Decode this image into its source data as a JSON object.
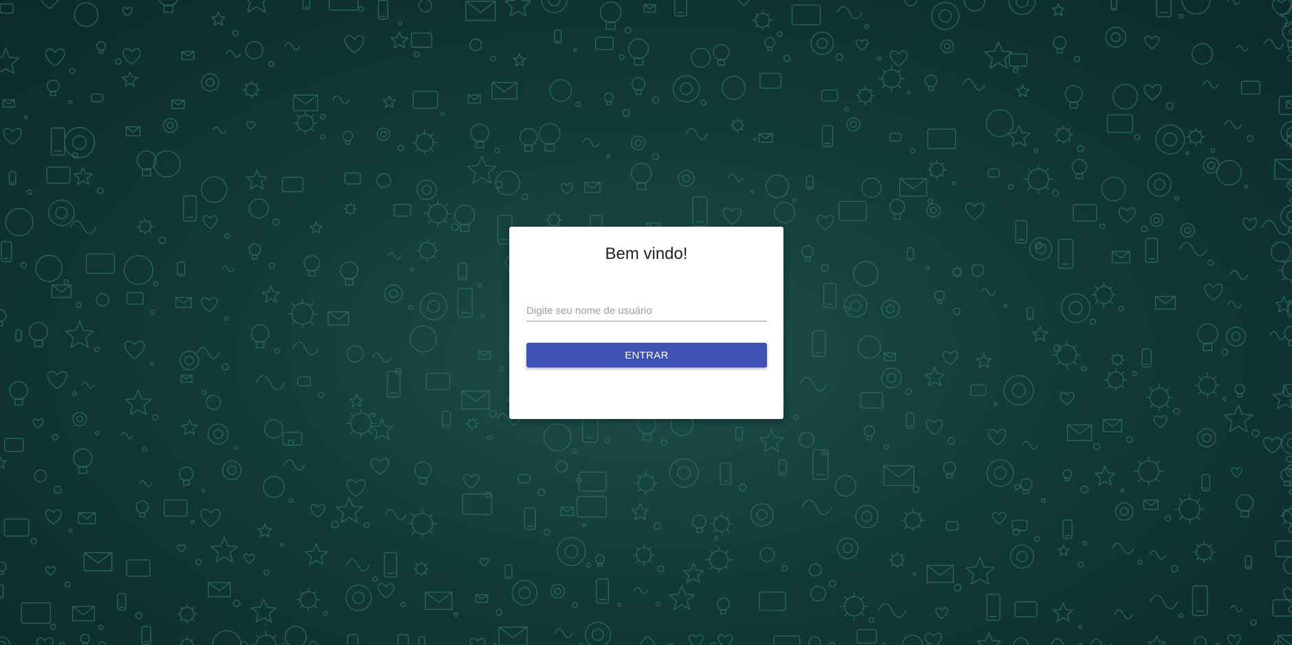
{
  "background": {
    "base_color": "#123a38",
    "doodle_color": "#2e6e68"
  },
  "login_card": {
    "title": "Bem vindo!",
    "username_placeholder": "Digite seu nome de usuário",
    "username_value": "",
    "submit_label": "ENTRAR",
    "submit_color": "#3f51b5"
  }
}
